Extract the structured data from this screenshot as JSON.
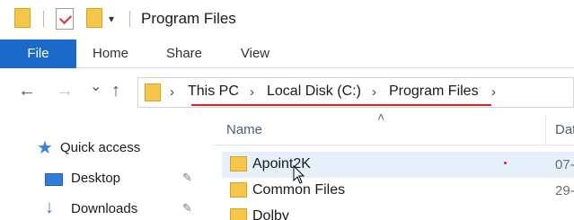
{
  "window": {
    "title": "Program Files"
  },
  "quick_access_toolbar": {
    "dropdown_glyph": "▾"
  },
  "ribbon": {
    "tabs": [
      "File",
      "Home",
      "Share",
      "View"
    ]
  },
  "navigation": {
    "back_glyph": "←",
    "forward_glyph": "→",
    "recent_glyph": "⌄",
    "up_glyph": "↑"
  },
  "address_bar": {
    "breadcrumbs": [
      "This PC",
      "Local Disk (C:)",
      "Program Files"
    ],
    "separator": "›"
  },
  "columns": {
    "name": "Name",
    "date": "Dat",
    "sort_glyph": "˄"
  },
  "nav_pane": {
    "items": [
      {
        "label": "Quick access",
        "icon": "star-icon"
      },
      {
        "label": "Desktop",
        "icon": "desktop-icon",
        "pinned": true
      },
      {
        "label": "Downloads",
        "icon": "download-icon",
        "pinned": true
      }
    ],
    "pin_glyph": "✎"
  },
  "files": [
    {
      "name": "Apoint2K",
      "date": "07-"
    },
    {
      "name": "Common Files",
      "date": "29-"
    },
    {
      "name": "Dolby",
      "date": ""
    }
  ],
  "colors": {
    "accent": "#1b6ac9",
    "folder": "#f5c64a",
    "annotation": "#e02020"
  }
}
